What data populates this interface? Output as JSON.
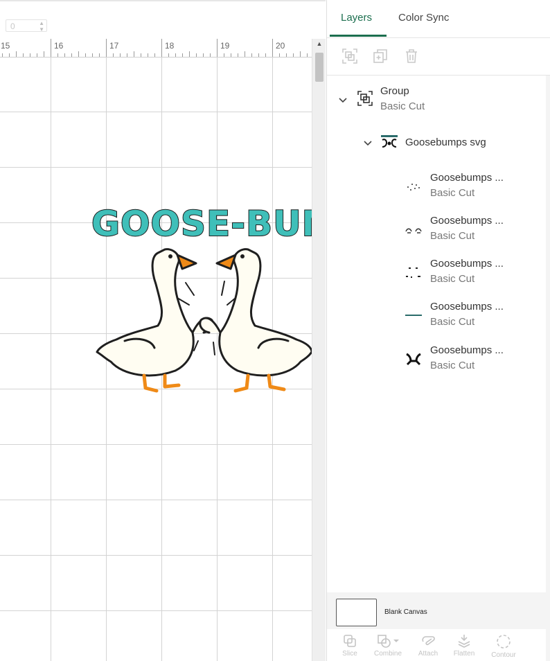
{
  "top_input": {
    "value": "0"
  },
  "ruler": {
    "labels": [
      "15",
      "16",
      "17",
      "18",
      "19",
      "20"
    ]
  },
  "design": {
    "title_text": "GOOSE-BUMP",
    "title_color": "#3fbfb9",
    "outline_color": "#1f1f1f",
    "goose_fill": "#fffdf2",
    "beak_color": "#ef8a17"
  },
  "panel": {
    "tabs": [
      {
        "label": "Layers",
        "active": true
      },
      {
        "label": "Color Sync",
        "active": false
      }
    ],
    "toolbar": {
      "icons": [
        "group-icon",
        "duplicate-icon",
        "delete-icon"
      ]
    },
    "layers": {
      "group": {
        "title": "Group",
        "subtitle": "Basic Cut",
        "icon": "group-icon"
      },
      "svg": {
        "title": "Goosebumps svg"
      },
      "children": [
        {
          "title": "Goosebumps ...",
          "subtitle": "Basic Cut"
        },
        {
          "title": "Goosebumps ...",
          "subtitle": "Basic Cut"
        },
        {
          "title": "Goosebumps ...",
          "subtitle": "Basic Cut"
        },
        {
          "title": "Goosebumps ...",
          "subtitle": "Basic Cut"
        },
        {
          "title": "Goosebumps ...",
          "subtitle": "Basic Cut"
        }
      ]
    },
    "blank_canvas": {
      "label": "Blank Canvas"
    },
    "actions": [
      {
        "label": "Slice"
      },
      {
        "label": "Combine"
      },
      {
        "label": "Attach"
      },
      {
        "label": "Flatten"
      },
      {
        "label": "Contour"
      }
    ]
  }
}
